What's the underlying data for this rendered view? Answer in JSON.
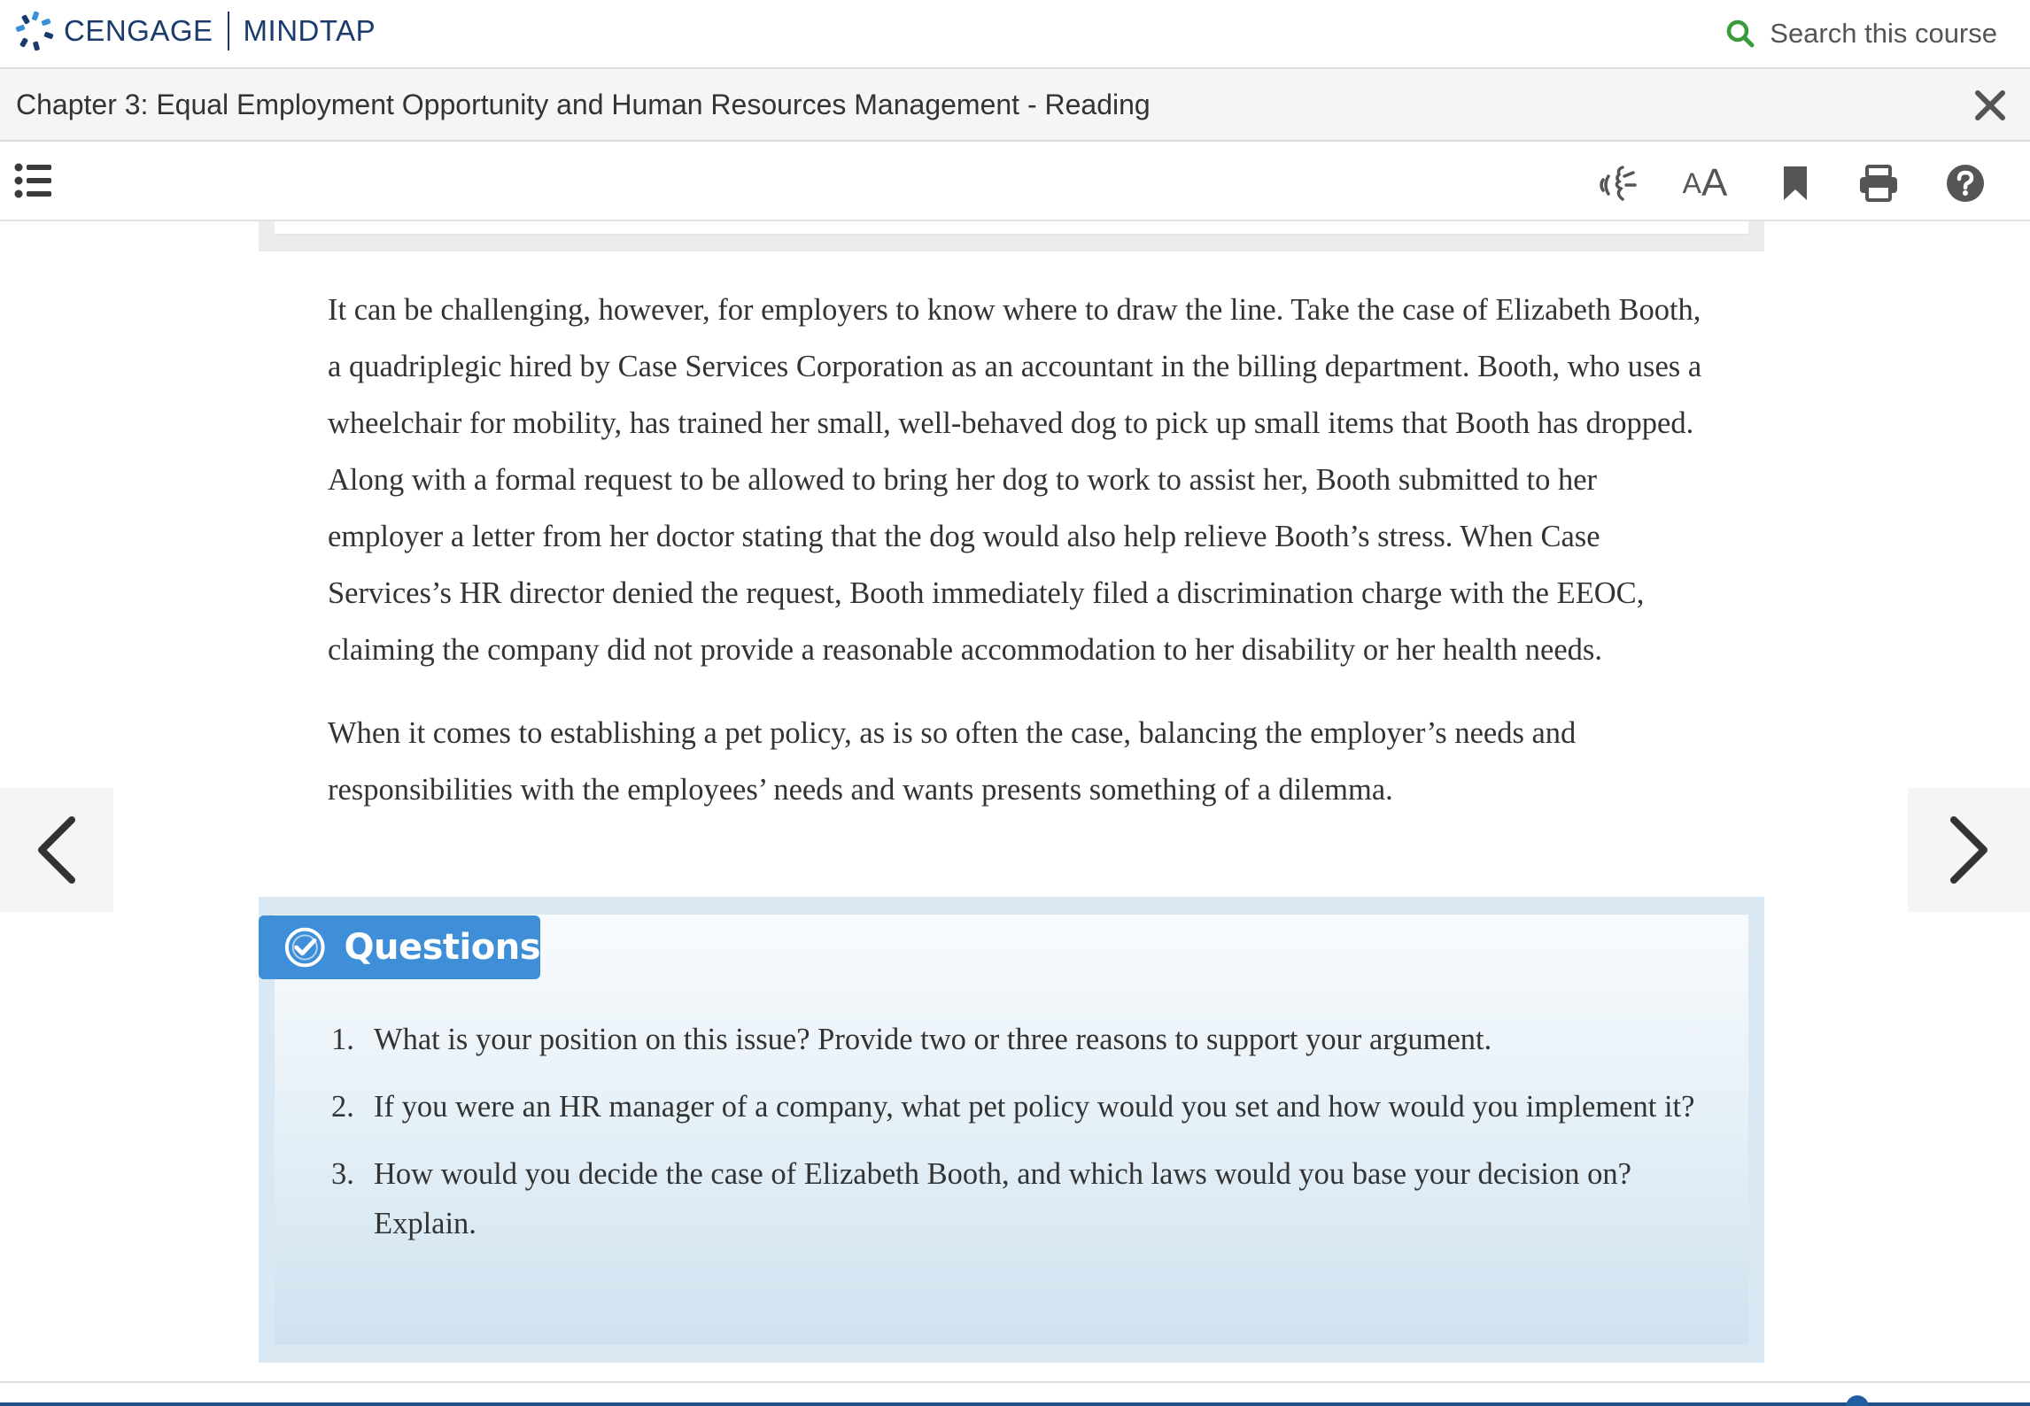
{
  "brand": {
    "name": "CENGAGE",
    "product": "MINDTAP"
  },
  "search": {
    "label": "Search this course"
  },
  "chapter": {
    "title": "Chapter 3: Equal Employment Opportunity and Human Resources Management - Reading"
  },
  "toolbar": {
    "font_small": "A",
    "font_big": "A"
  },
  "colors": {
    "brand_blue": "#1a3b6b",
    "search_green": "#3a9b3a",
    "badge_blue": "#3f8fd8",
    "question_bg": "#d9e8f3",
    "progress": "#1f4f86"
  },
  "icons": {
    "logo": "cengage-logo",
    "search": "search-icon",
    "close": "close-icon",
    "toc": "list-icon",
    "read_aloud": "read-aloud-icon",
    "font_size": "font-size-icon",
    "bookmark": "bookmark-icon",
    "print": "print-icon",
    "help": "help-icon",
    "prev": "chevron-left-icon",
    "next": "chevron-right-icon",
    "questions": "check-circle-icon"
  },
  "content": {
    "paragraphs": [
      "It can be challenging, however, for employers to know where to draw the line. Take the case of Elizabeth Booth, a quadriplegic hired by Case Services Corporation as an accountant in the billing department. Booth, who uses a wheelchair for mobility, has trained her small, well-behaved dog to pick up small items that Booth has dropped. Along with a formal request to be allowed to bring her dog to work to assist her, Booth submitted to her employer a letter from her doctor stating that the dog would also help relieve Booth’s stress. When Case Services’s HR director denied the request, Booth immediately filed a discrimination charge with the EEOC, claiming the company did not provide a reasonable accommodation to her disability or her health needs.",
      "When it comes to establishing a pet policy, as is so often the case, balancing the employer’s needs and responsibilities with the employees’ needs and wants presents something of a dilemma."
    ]
  },
  "questions": {
    "heading": "Questions",
    "items": [
      {
        "num": "1.",
        "text": "What is your position on this issue? Provide two or three reasons to support your argument."
      },
      {
        "num": "2.",
        "text": "If you were an HR manager of a company, what pet policy would you set and how would you implement it?"
      },
      {
        "num": "3.",
        "text": "How would you decide the case of Elizabeth Booth, and which laws would you base your decision on? Explain."
      }
    ]
  }
}
